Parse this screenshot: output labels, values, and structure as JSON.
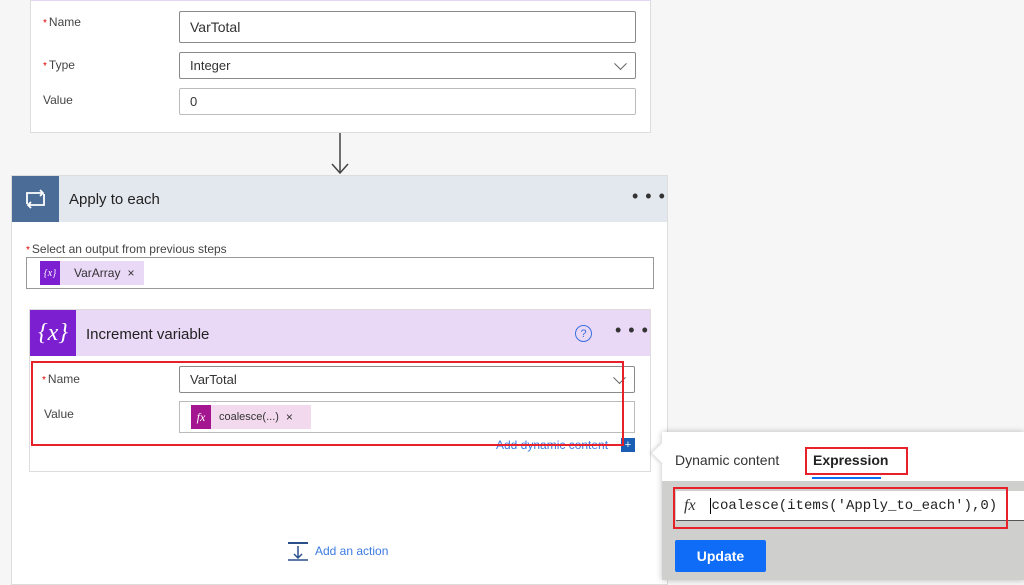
{
  "init_variable": {
    "name_label": "Name",
    "name_value": "VarTotal",
    "type_label": "Type",
    "type_value": "Integer",
    "value_label": "Value",
    "value_value": "0"
  },
  "apply_to_each": {
    "title": "Apply to each",
    "more": "...",
    "select_label": "Select an output from previous steps",
    "token_label": "VarArray",
    "token_icon": "{x}",
    "remove": "×"
  },
  "increment_variable": {
    "title": "Increment variable",
    "icon": "{x}",
    "help": "?",
    "more": "...",
    "name_label": "Name",
    "name_value": "VarTotal",
    "value_label": "Value",
    "token_icon": "fx",
    "token_label": "coalesce(...)",
    "remove": "×",
    "add_dynamic": "Add dynamic content",
    "add_plus": "+"
  },
  "add_action": "Add an action",
  "popup": {
    "tab_dynamic": "Dynamic content",
    "tab_expression": "Expression",
    "fx": "fx",
    "expression": "coalesce(items('Apply_to_each'),0)",
    "update": "Update"
  },
  "colors": {
    "loop": "#4a6c96",
    "variable": "#7b1fd1",
    "expression": "#a3168f",
    "accent": "#0f6cf7",
    "highlight": "#e8202a"
  }
}
